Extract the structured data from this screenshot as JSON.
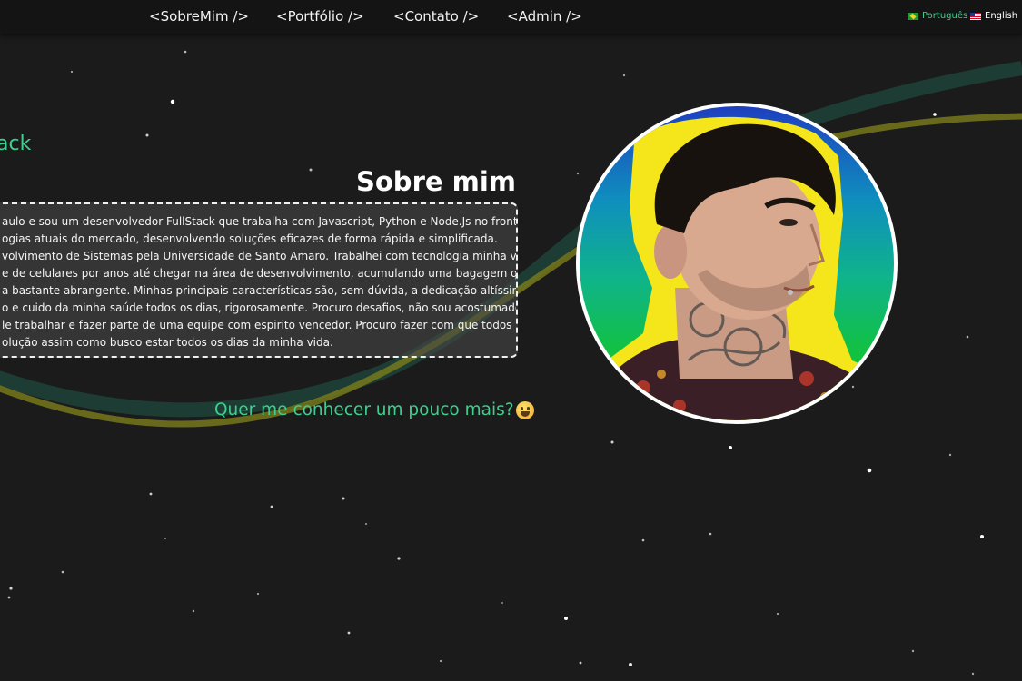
{
  "nav": {
    "links": [
      "<SobreMim />",
      "<Portfólio />",
      "<Contato />",
      "<Admin />"
    ],
    "languages": [
      "Português",
      "English"
    ],
    "active_language": "Português"
  },
  "hero": {
    "stack_text": "ack",
    "title": "Sobre mim",
    "paragraph_lines": [
      "aulo e sou um desenvolvedor FullStack que trabalha com Javascript, Python e Node.Js no front e no",
      "ogias atuais do mercado, desenvolvendo soluções eficazes de forma rápida e simplificada.",
      "volvimento de Sistemas pela Universidade de Santo Amaro. Trabalhei com tecnologia minha vida",
      "e de celulares por anos até chegar na área de desenvolvimento, acumulando uma bagagem que me",
      "a bastante abrangente. Minhas principais características são, sem dúvida, a dedicação altíssima e",
      "o e cuido da minha saúde todos os dias, rigorosamente. Procuro desafios, não sou acostumado a",
      "le trabalhar e fazer parte de uma equipe com espirito vencedor. Procuro fazer com que todos à",
      "olução assim como busco estar todos os dias da minha vida."
    ],
    "cta": "Quer me conhecer um pouco mais?"
  },
  "colors": {
    "accent": "#3ecf8e",
    "background": "#1b1b1b",
    "navbar": "#141414",
    "wave_yellow": "#8a8a1a",
    "wave_teal": "#1f4a3d"
  },
  "icons": {
    "flag_pt": "brazil-flag-icon",
    "flag_en": "us-flag-icon",
    "cta_emoji": "grinning-face-icon"
  }
}
